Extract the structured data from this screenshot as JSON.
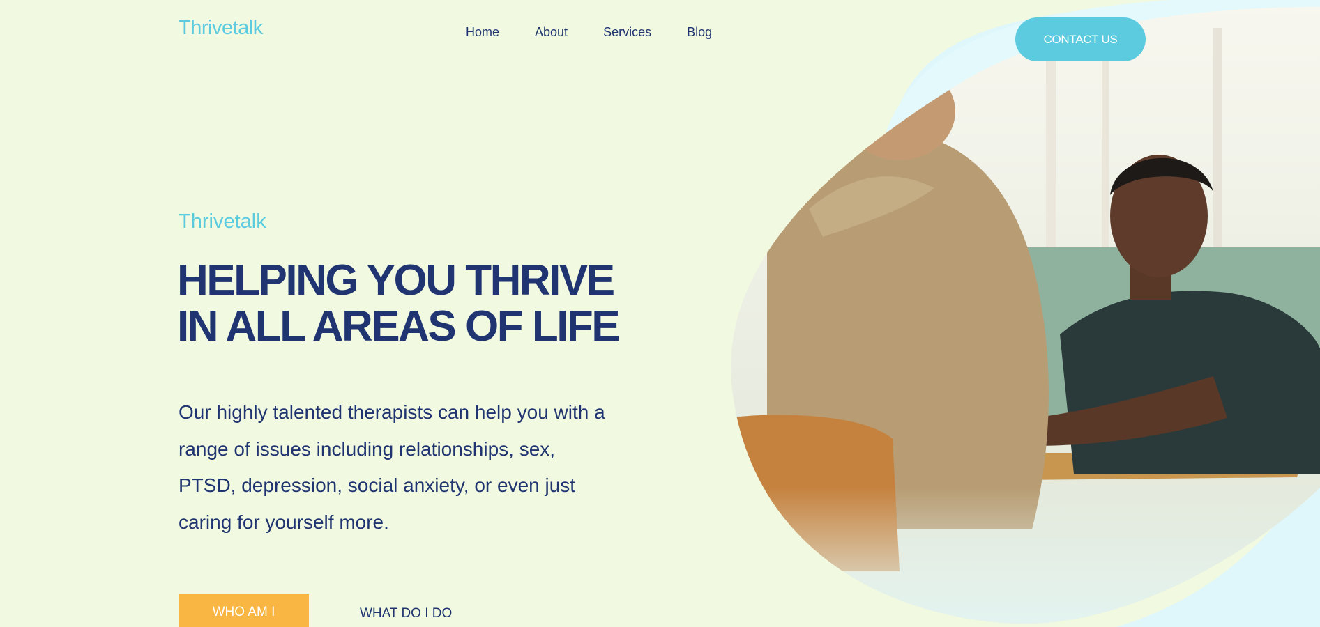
{
  "header": {
    "logo": "Thrivetalk",
    "nav": [
      "Home",
      "About",
      "Services",
      "Blog"
    ],
    "cta": "CONTACT US"
  },
  "hero": {
    "eyebrow": "Thrivetalk",
    "headline_line1": "HELPING YOU THRIVE",
    "headline_line2": "IN ALL AREAS OF LIFE",
    "body": "Our highly talented therapists can help you with a range of issues including relationships, sex, PTSD, depression, social anxiety, or even just caring for yourself more.",
    "primary_button": "WHO AM I",
    "secondary_button": "WHAT DO I DO"
  },
  "colors": {
    "background": "#f1f9e0",
    "accent": "#5ccbdf",
    "navy": "#1f3470",
    "button_orange": "#f9b642"
  }
}
